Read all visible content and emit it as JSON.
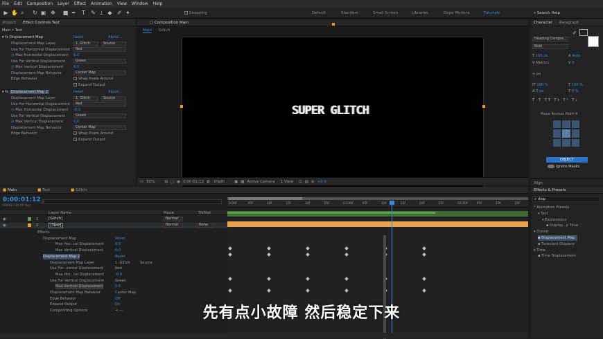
{
  "menu": [
    "File",
    "Edit",
    "Composition",
    "Layer",
    "Effect",
    "Animation",
    "View",
    "Window",
    "Help"
  ],
  "toolbar": {
    "snapping": "Snapping",
    "workspaces": [
      "Default",
      "Standard",
      "Small Screen",
      "Libraries",
      "Dope Motions",
      "Tutorials"
    ],
    "search": "Search Help"
  },
  "project": {
    "tabs": [
      "Project",
      "Effect Controls Text"
    ],
    "subtitle": "Main • Text",
    "effect1": {
      "name": "Displacement Map",
      "reset": "Reset",
      "about": "About...",
      "rows": [
        {
          "label": "Displacement Map Layer",
          "v1": "1. Glitch",
          "v2": "Source"
        },
        {
          "label": "Use For Horizontal Displacement",
          "v1": "Red"
        },
        {
          "label": "Max Horizontal Displacement",
          "v1": "6.0"
        },
        {
          "label": "Use For Vertical Displacement",
          "v1": "Green"
        },
        {
          "label": "Max Vertical Displacement",
          "v1": "6.0"
        },
        {
          "label": "Displacement Map Behavior",
          "v1": "Center Map"
        },
        {
          "label": "Edge Behavior",
          "v1": "Wrap Pixels Around"
        },
        {
          "label": "",
          "v1": "Expand Output"
        }
      ]
    },
    "effect2": {
      "name": "Displacement Map 2",
      "reset": "Reset",
      "about": "About...",
      "rows": [
        {
          "label": "Displacement Map Layer",
          "v1": "1. Glitch",
          "v2": "Source"
        },
        {
          "label": "Use For Horizontal Displacement",
          "v1": "Red"
        },
        {
          "label": "Max Horizontal Displacement",
          "v1": "-8.0"
        },
        {
          "label": "Use For Vertical Displacement",
          "v1": "Green"
        },
        {
          "label": "Max Vertical Displacement",
          "v1": "0.0"
        },
        {
          "label": "Displacement Map Behavior",
          "v1": "Center Map"
        },
        {
          "label": "Edge Behavior",
          "v1": "Wrap Pixels Around"
        },
        {
          "label": "",
          "v1": "Expand Output"
        }
      ]
    }
  },
  "comp": {
    "tab": "Composition Main",
    "subtabs": [
      "Main",
      "Glitch"
    ],
    "title_text": "SUPER GLITCH",
    "zoom": "50%",
    "time": "0:00:01:12",
    "res": "(Half)",
    "camera": "Active Camera",
    "view": "1 View",
    "exposure": "+0.0"
  },
  "character": {
    "tabs": [
      "Character",
      "Paragraph"
    ],
    "font": "Heading Compre...",
    "style": "Bold",
    "size": "165 px",
    "leading": "Auto",
    "kerning": "Metrics",
    "tracking": "0",
    "unit": "px",
    "vscale": "100 %",
    "hscale": "100 %",
    "baseline": "0 px",
    "tsume": "0 %"
  },
  "anchor": {
    "title": "Move Anchor Point 4",
    "object": "OBJECT",
    "ignore": "Ignore Masks"
  },
  "align": {
    "tab": "Align"
  },
  "effects_presets": {
    "tab": "Effects & Presets",
    "search": "disp",
    "tree": [
      "* Animation Presets",
      "Text",
      "Expressions",
      "Display...p Time",
      "Distort",
      "Displacement Map",
      "Turbulent Displace",
      "Time",
      "Time Displacement"
    ]
  },
  "timeline": {
    "tabs": [
      "Main",
      "Text",
      "Glitch"
    ],
    "time": "0:00:01:12",
    "fps": "00042 (30.00 fps)",
    "col_name": "Layer Name",
    "col_mode": "Mode",
    "col_trkmat": "TrkMat",
    "layers": [
      {
        "num": "1",
        "name": "[Glitch]",
        "mode": "Normal"
      },
      {
        "num": "2",
        "name": "[Text]",
        "mode": "Normal",
        "trk": "None"
      }
    ],
    "props": [
      {
        "label": "Effects"
      },
      {
        "label": "Displacement Map",
        "v": "Reset"
      },
      {
        "label": "Max Hor...tal Displacement",
        "v": "6.0"
      },
      {
        "label": "Max Vertical Displacement",
        "v": "6.0"
      },
      {
        "label": "Displacement Map 2",
        "v": "Reset"
      },
      {
        "label": "Displacement Map Layer",
        "v": "1. Glitch",
        "v2": "Source"
      },
      {
        "label": "Use For...zontal Displacement",
        "v": "Red"
      },
      {
        "label": "Max Hor...tal Displacement",
        "v": "-8.0"
      },
      {
        "label": "Use For Vertical Displacement",
        "v": "Green"
      },
      {
        "label": "Max Vertical Displacement",
        "v": "0.0"
      },
      {
        "label": "Displacement Map Behavior",
        "v": "Center Map"
      },
      {
        "label": "Edge Behavior",
        "v": "Off"
      },
      {
        "label": "Expand Output",
        "v": "On"
      },
      {
        "label": "Compositing Options",
        "v": "+ —"
      }
    ],
    "ruler": [
      "0:00f",
      "05f",
      "10f",
      "15f",
      "20f",
      "25f",
      "01:00f",
      "05f",
      "10f",
      "15f",
      "20f",
      "25f",
      "02:00f",
      "05f",
      "10f",
      "15f"
    ]
  },
  "subtitle": "先有点小故障 然后稳定下来"
}
